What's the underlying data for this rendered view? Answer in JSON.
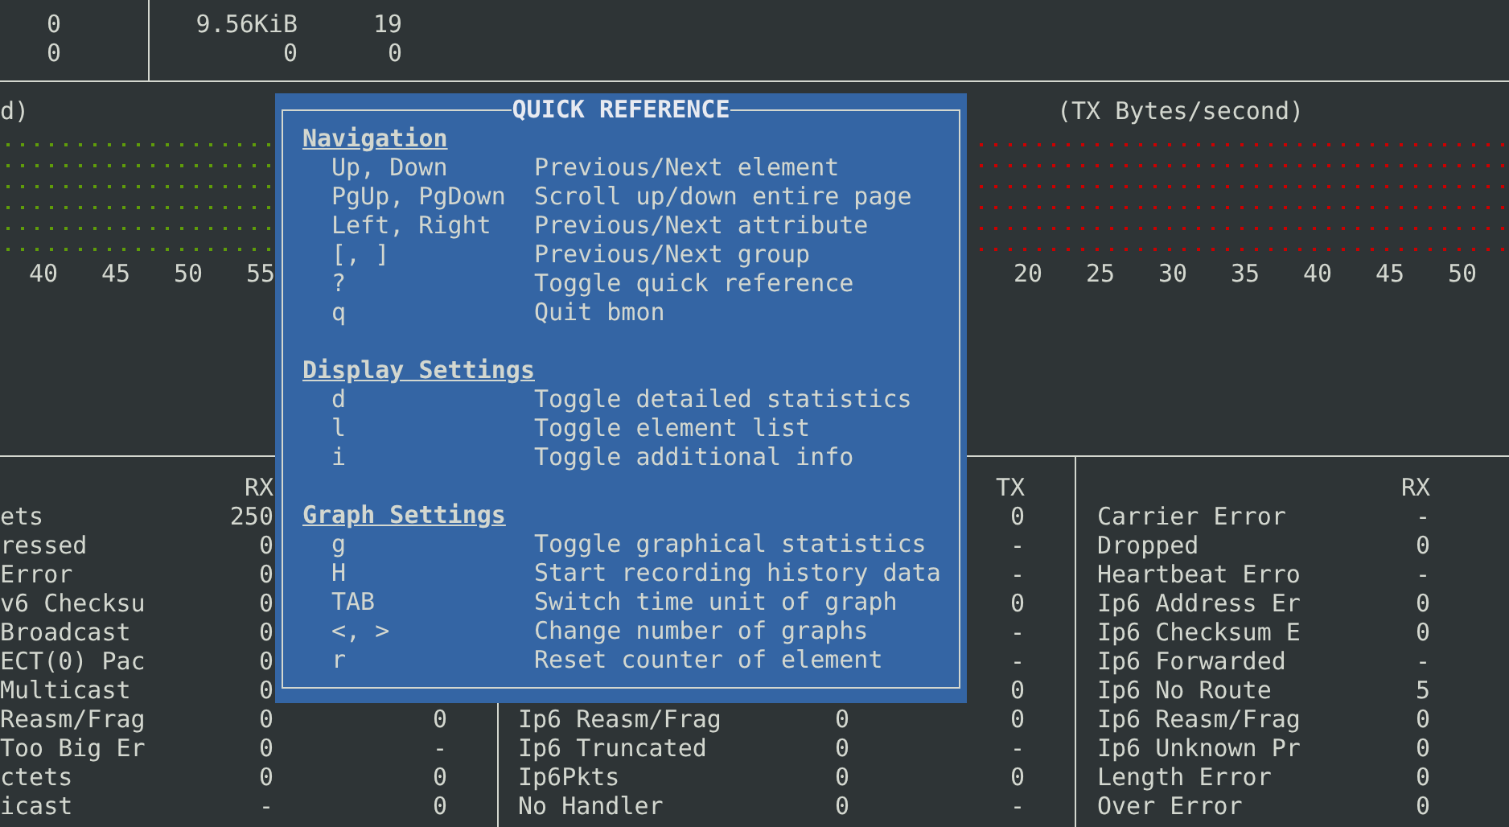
{
  "top_table": {
    "rows": [
      {
        "column_1": "0",
        "column_2": "9.56KiB",
        "column_3": "19"
      },
      {
        "column_1": "0",
        "column_2": "0",
        "column_3": "0"
      }
    ]
  },
  "graphs": [
    {
      "title": "d)",
      "color": "#5f9c0a",
      "x_ticks": [
        "40",
        "45",
        "50",
        "55"
      ]
    },
    {
      "title": "(TX Bytes/second)",
      "color": "#cc0000",
      "x_ticks": [
        "20",
        "25",
        "30",
        "35",
        "40",
        "45",
        "50"
      ]
    }
  ],
  "stat_columns": [
    {
      "header": {
        "rx": "RX"
      },
      "rows": [
        {
          "label": "ets",
          "rx": "250"
        },
        {
          "label": "ressed",
          "rx": "0"
        },
        {
          "label": "Error",
          "rx": "0"
        },
        {
          "label": "v6 Checksu",
          "rx": "0"
        },
        {
          "label": "Broadcast",
          "rx": "0"
        },
        {
          "label": "ECT(0) Pac",
          "rx": "0"
        },
        {
          "label": "Multicast",
          "rx": "0"
        },
        {
          "label": "Reasm/Frag",
          "rx": "0",
          "tx": "0"
        },
        {
          "label": "Too Big Er",
          "rx": "0",
          "tx": "-"
        },
        {
          "label": "ctets",
          "rx": "0",
          "tx": "0"
        },
        {
          "label": "icast",
          "rx": "-",
          "tx": "0"
        }
      ]
    },
    {
      "header": {
        "tx": "TX"
      },
      "rows": [
        {
          "tx": "0"
        },
        {
          "tx": "-"
        },
        {
          "tx": "-"
        },
        {
          "tx": "0"
        },
        {
          "tx": "-"
        },
        {
          "tx": "-"
        },
        {
          "tx": "0"
        },
        {
          "label": "Ip6 Reasm/Frag",
          "rx": "0",
          "tx": "0"
        },
        {
          "label": "Ip6 Truncated",
          "rx": "0",
          "tx": "-"
        },
        {
          "label": "Ip6Pkts",
          "rx": "0",
          "tx": "0"
        },
        {
          "label": "No Handler",
          "rx": "0",
          "tx": "-"
        }
      ]
    },
    {
      "header": {
        "rx": "RX"
      },
      "rows": [
        {
          "label": "Carrier Error",
          "rx": "-"
        },
        {
          "label": "Dropped",
          "rx": "0"
        },
        {
          "label": "Heartbeat Erro",
          "rx": "-"
        },
        {
          "label": "Ip6 Address Er",
          "rx": "0"
        },
        {
          "label": "Ip6 Checksum E",
          "rx": "0"
        },
        {
          "label": "Ip6 Forwarded",
          "rx": "-"
        },
        {
          "label": "Ip6 No Route",
          "rx": "5"
        },
        {
          "label": "Ip6 Reasm/Frag",
          "rx": "0"
        },
        {
          "label": "Ip6 Unknown Pr",
          "rx": "0"
        },
        {
          "label": "Length Error",
          "rx": "0"
        },
        {
          "label": "Over Error",
          "rx": "0"
        }
      ]
    }
  ],
  "quick_reference": {
    "title": "QUICK REFERENCE",
    "sections": [
      {
        "heading": "Navigation",
        "items": [
          {
            "key": "Up, Down",
            "action": "Previous/Next element"
          },
          {
            "key": "PgUp, PgDown",
            "action": "Scroll up/down entire page"
          },
          {
            "key": "Left, Right",
            "action": "Previous/Next attribute"
          },
          {
            "key": "[, ]",
            "action": "Previous/Next group"
          },
          {
            "key": "?",
            "action": "Toggle quick reference"
          },
          {
            "key": "q",
            "action": "Quit bmon"
          }
        ]
      },
      {
        "heading": "Display Settings",
        "items": [
          {
            "key": "d",
            "action": "Toggle detailed statistics"
          },
          {
            "key": "l",
            "action": "Toggle element list"
          },
          {
            "key": "i",
            "action": "Toggle additional info"
          }
        ]
      },
      {
        "heading": "Graph Settings",
        "items": [
          {
            "key": "g",
            "action": "Toggle graphical statistics"
          },
          {
            "key": "H",
            "action": "Start recording history data"
          },
          {
            "key": "TAB",
            "action": "Switch time unit of graph"
          },
          {
            "key": "<, >",
            "action": "Change number of graphs"
          },
          {
            "key": "r",
            "action": "Reset counter of element"
          }
        ]
      }
    ]
  }
}
